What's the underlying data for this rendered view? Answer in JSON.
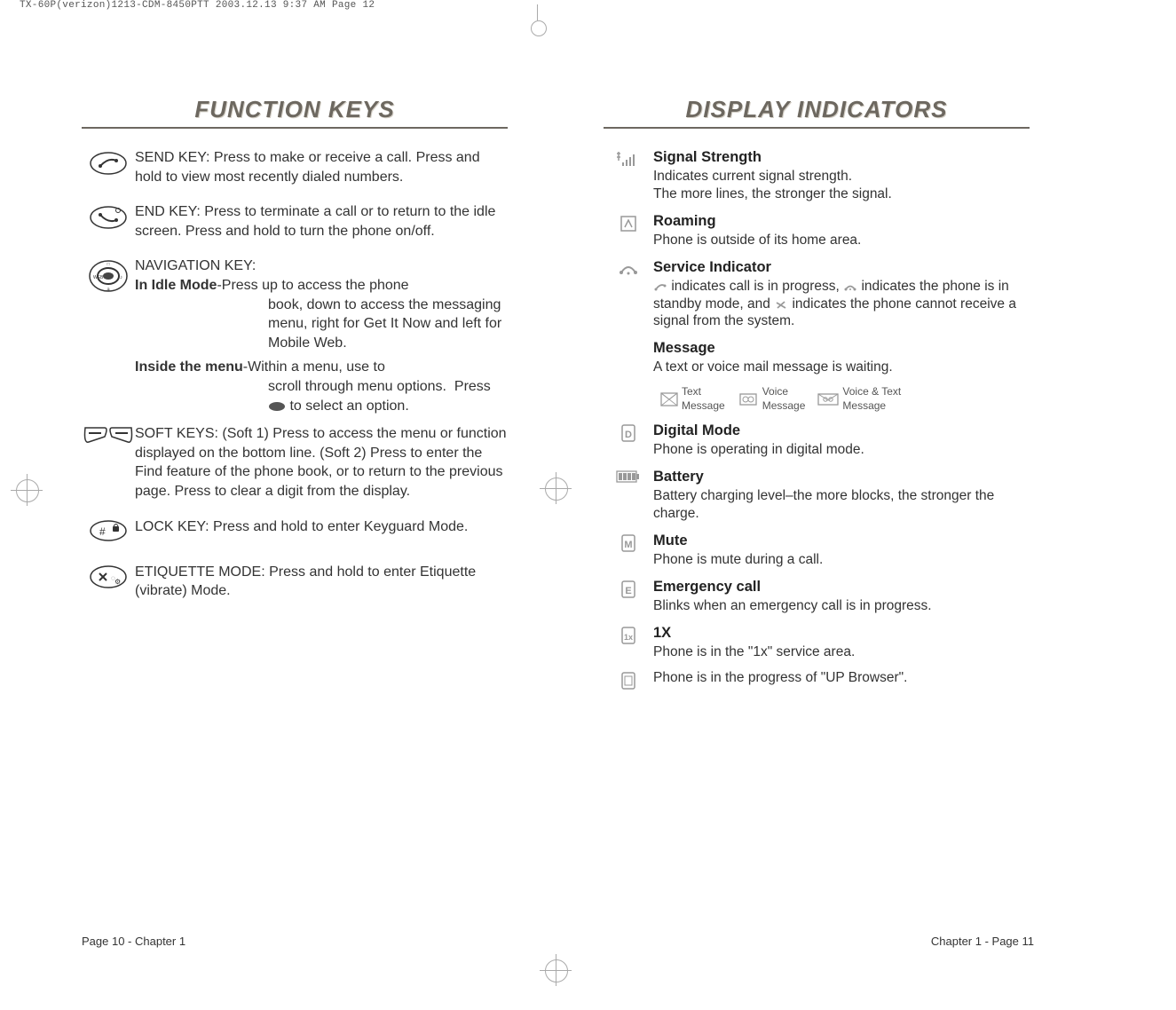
{
  "meta_line": "TX-60P(verizon)1213-CDM-8450PTT  2003.12.13  9:37 AM  Page 12",
  "left": {
    "title": "FUNCTION KEYS",
    "send_key": "SEND KEY: Press to make or receive a call.  Press and hold to view most recently dialed numbers.",
    "end_key": "END KEY: Press to terminate a call or to return to the idle screen.  Press and hold to turn the phone on/off.",
    "nav_key_label": "NAVIGATION KEY:",
    "nav_idle_lead": "In Idle Mode",
    "nav_idle_text": "-Press up to access the phone book, down to access the messaging menu, right for Get It Now and left for Mobile Web.",
    "nav_menu_lead": "Inside the menu",
    "nav_menu_text": "-Within a menu, use to scroll through menu options.  Press        to select an option.",
    "soft_keys": "SOFT KEYS: (Soft 1) Press to access the menu or function displayed on the bottom line. (Soft 2) Press to enter the Find feature of the phone book, or to return to the previous page.  Press to clear a digit from the display.",
    "lock_key": "LOCK KEY: Press and hold to enter Keyguard Mode.",
    "etiquette": "ETIQUETTE MODE: Press and hold to enter Etiquette (vibrate) Mode.",
    "footer": "Page 10 - Chapter 1"
  },
  "right": {
    "title": "DISPLAY INDICATORS",
    "signal_t": "Signal Strength",
    "signal_d": "Indicates current signal strength.\nThe more lines, the stronger the signal.",
    "roam_t": "Roaming",
    "roam_d": "Phone is outside of its home area.",
    "service_t": "Service Indicator",
    "service_d_1": "indicates call is in progress,",
    "service_d_2": "indicates the phone is in standby mode, and",
    "service_d_3": "indicates the phone cannot receive a signal from the system.",
    "message_t": "Message",
    "message_d": "A text or voice mail message is waiting.",
    "msg_text": "Text\nMessage",
    "msg_voice": "Voice\nMessage",
    "msg_both": "Voice & Text\nMessage",
    "digital_t": "Digital Mode",
    "digital_d": "Phone is operating in digital mode.",
    "battery_t": "Battery",
    "battery_d": "Battery charging level–the more blocks, the stronger the charge.",
    "mute_t": "Mute",
    "mute_d": "Phone is mute during a call.",
    "emerg_t": "Emergency call",
    "emerg_d": "Blinks when an emergency call is in progress.",
    "onex_t": "1X",
    "onex_d": "Phone is in the \"1x\" service area.",
    "browser_d": "Phone is in the progress of \"UP Browser\".",
    "footer": "Chapter 1 - Page 11"
  }
}
